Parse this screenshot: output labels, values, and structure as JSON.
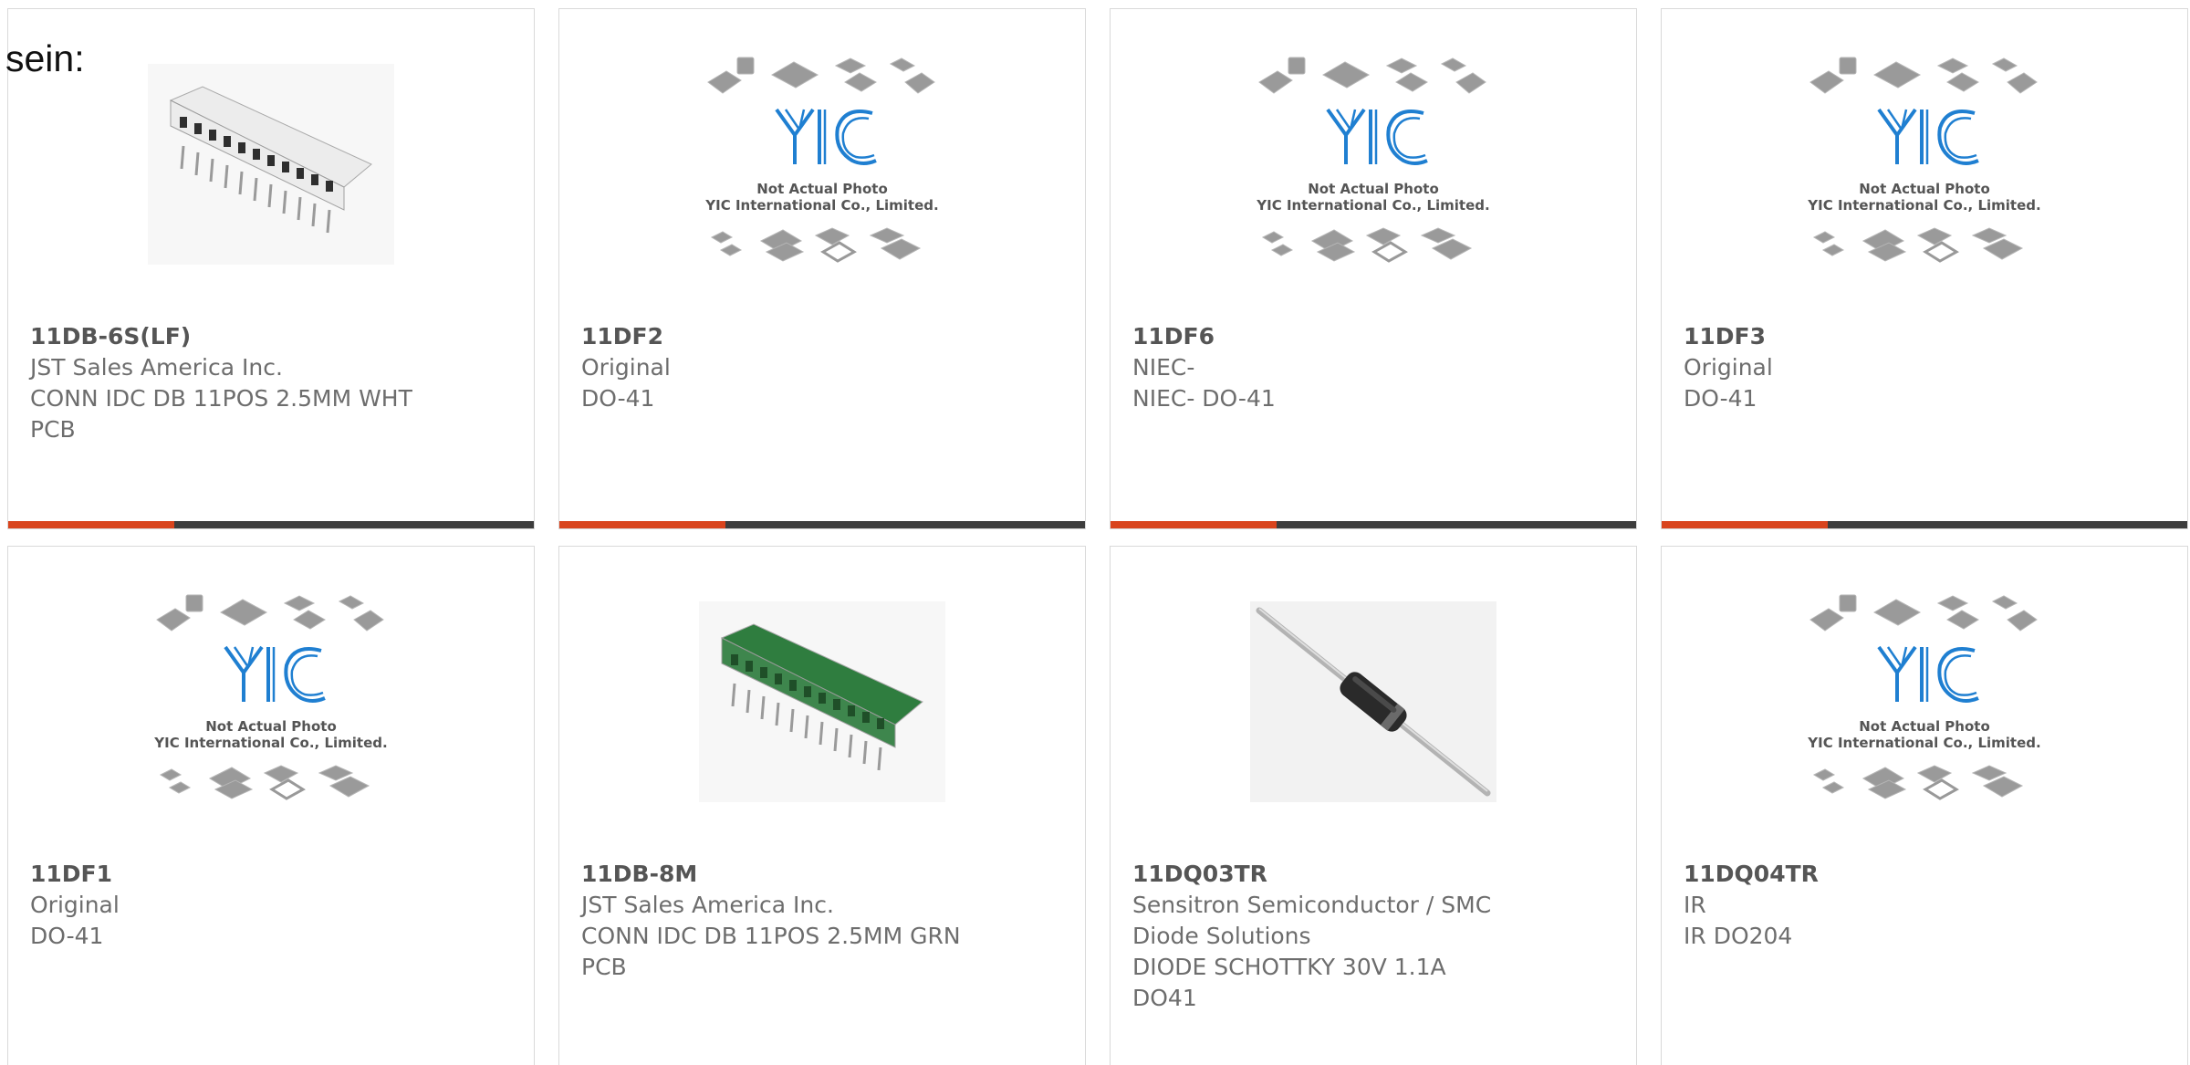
{
  "stray_text": "sein:",
  "placeholder_caption": {
    "line1": "Not Actual Photo",
    "line2": "YIC International Co., Limited."
  },
  "colors": {
    "accent": "#d9441d",
    "bar": "#3d3d3d",
    "border": "#d9d9d9",
    "logo": "#1f7fd1"
  },
  "products": [
    {
      "part": "11DB-6S(LF)",
      "lines": [
        "JST Sales America Inc.",
        "CONN IDC DB 11POS 2.5MM WHT",
        "PCB"
      ],
      "image": "connector-white-photo"
    },
    {
      "part": "11DF2",
      "lines": [
        "Original",
        "DO-41"
      ],
      "image": "yic-placeholder"
    },
    {
      "part": "11DF6",
      "lines": [
        "NIEC-",
        "NIEC- DO-41"
      ],
      "image": "yic-placeholder"
    },
    {
      "part": "11DF3",
      "lines": [
        "Original",
        "DO-41"
      ],
      "image": "yic-placeholder"
    },
    {
      "part": "11DF1",
      "lines": [
        "Original",
        "DO-41"
      ],
      "image": "yic-placeholder"
    },
    {
      "part": "11DB-8M",
      "lines": [
        "JST Sales America Inc.",
        "CONN IDC DB 11POS 2.5MM GRN",
        "PCB"
      ],
      "image": "connector-green-photo"
    },
    {
      "part": "11DQ03TR",
      "lines": [
        "Sensitron Semiconductor / SMC",
        "Diode Solutions",
        "DIODE SCHOTTKY 30V 1.1A",
        "DO41"
      ],
      "image": "diode-photo"
    },
    {
      "part": "11DQ04TR",
      "lines": [
        "IR",
        "IR DO204"
      ],
      "image": "yic-placeholder"
    }
  ]
}
